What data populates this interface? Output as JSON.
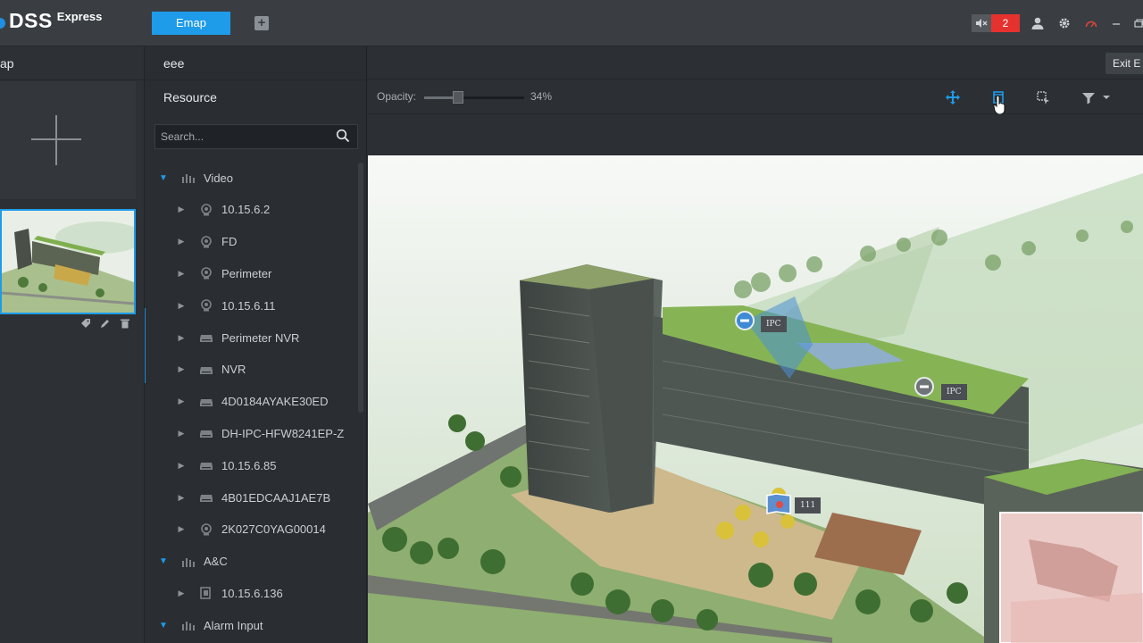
{
  "app": {
    "logo_main": "DSS",
    "logo_sub": "Express"
  },
  "topbar": {
    "active_tab": "Emap",
    "add_tab": "+",
    "alarm_count": "2"
  },
  "left_panel": {
    "title": "ap"
  },
  "resource_panel": {
    "map_name": "eee",
    "title": "Resource",
    "search_placeholder": "Search...",
    "tree": [
      {
        "label": "Video",
        "level": 0,
        "expanded": true,
        "icon": "group-icon"
      },
      {
        "label": "10.15.6.2",
        "level": 1,
        "icon": "camera-device-icon"
      },
      {
        "label": "FD",
        "level": 1,
        "icon": "camera-device-icon"
      },
      {
        "label": "Perimeter",
        "level": 1,
        "icon": "camera-device-icon"
      },
      {
        "label": "10.15.6.11",
        "level": 1,
        "icon": "camera-device-icon"
      },
      {
        "label": "Perimeter NVR",
        "level": 1,
        "icon": "nvr-icon"
      },
      {
        "label": "NVR",
        "level": 1,
        "icon": "nvr-icon"
      },
      {
        "label": "4D0184AYAKE30ED",
        "level": 1,
        "icon": "nvr-icon"
      },
      {
        "label": "DH-IPC-HFW8241EP-Z",
        "level": 1,
        "icon": "nvr-icon"
      },
      {
        "label": "10.15.6.85",
        "level": 1,
        "icon": "nvr-icon"
      },
      {
        "label": "4B01EDCAAJ1AE7B",
        "level": 1,
        "icon": "nvr-icon"
      },
      {
        "label": "2K027C0YAG00014",
        "level": 1,
        "icon": "camera-device-icon"
      },
      {
        "label": "A&C",
        "level": 0,
        "expanded": true,
        "icon": "group-icon"
      },
      {
        "label": "10.15.6.136",
        "level": 1,
        "icon": "access-control-icon"
      },
      {
        "label": "Alarm Input",
        "level": 0,
        "expanded": true,
        "icon": "group-icon"
      }
    ]
  },
  "map_view": {
    "exit_button": "Exit E",
    "opacity_label": "Opacity:",
    "opacity_value": "34%",
    "opacity_fraction": 0.34,
    "markers": [
      {
        "label": "IPC"
      },
      {
        "label": "IPC"
      },
      {
        "label": "111"
      }
    ]
  },
  "colors": {
    "accent": "#1e9be9",
    "alarm": "#e6322e",
    "panel": "#2a2e32",
    "topbar": "#3a3e43"
  }
}
